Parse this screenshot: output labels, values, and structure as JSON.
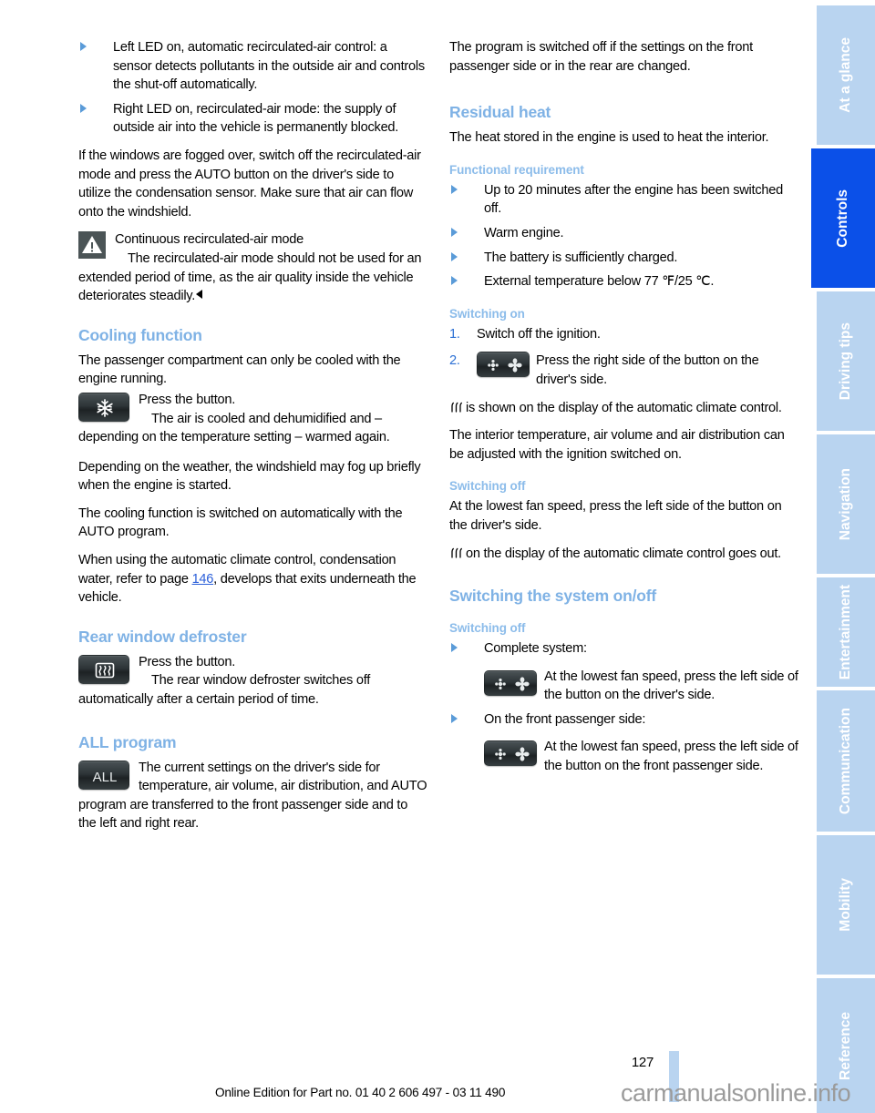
{
  "document": {
    "page_number": "127",
    "footer_note": "Online Edition for Part no. 01 40 2 606 497 - 03 11 490",
    "watermark": "carmanualsonline.info"
  },
  "colors": {
    "heading_blue": "#7fb2e5",
    "subheading_blue": "#8cbcea",
    "link_blue": "#2b5fd9",
    "tab_inactive": "#b9d4f0",
    "tab_active": "#0b50e8",
    "warning_icon_bg": "#4b5456",
    "button_dark": "#2e3538"
  },
  "left_column": {
    "bullets_top": [
      "Left LED on, automatic recirculated-air con-trol: a sensor detects pollutants in the out-side air and controls the shut-off automati-cally.",
      "Right LED on, recirculated-air mode: the supply of outside air into the vehicle is per-manently blocked."
    ],
    "bullet1_text": "Left LED on, automatic recirculated-air control: a sensor detects pollutants in the outside air and controls the shut-off automatically.",
    "bullet2_text": "Right LED on, recirculated-air mode: the supply of outside air into the vehicle is permanently blocked.",
    "para_fogged": "If the windows are fogged over, switch off the recirculated-air mode and press the AUTO button on the driver's side to utilize the condensation sensor. Make sure that air can flow onto the windshield.",
    "warning": {
      "icon": "warning-triangle-icon",
      "title": "Continuous recirculated-air mode",
      "body": "The recirculated-air mode should not be used for an extended period of time, as the air quality inside the vehicle deteriorates steadily."
    },
    "cooling": {
      "heading": "Cooling function",
      "intro": "The passenger compartment can only be cooled with the engine running.",
      "button_icon": "snowflake-button-icon",
      "press": "Press the button.",
      "result": "The air is cooled and dehumidified and – depending on the temperature setting – warmed again.",
      "fog_note": "Depending on the weather, the windshield may fog up briefly when the engine is started.",
      "auto_note": "The cooling function is switched on automatically with the AUTO program.",
      "condensation_pre": "When using the automatic climate control, condensation water, refer to page ",
      "condensation_page": "146",
      "condensation_post": ", develops that exits underneath the vehicle."
    },
    "defroster": {
      "heading": "Rear window defroster",
      "button_icon": "rear-window-defroster-button-icon",
      "press": "Press the button.",
      "body": "The rear window defroster switches off automatically after a certain period of time."
    },
    "all_program": {
      "heading": "ALL program",
      "button_label": "ALL",
      "body": "The current settings on the driver's side for temperature, air volume, air distribution, and AUTO program are transferred to the front passenger side and to the left and right rear."
    }
  },
  "right_column": {
    "intro_para": "The program is switched off if the settings on the front passenger side or in the rear are changed.",
    "residual_heat": {
      "heading": "Residual heat",
      "intro": "The heat stored in the engine is used to heat the interior.",
      "functional_requirement": {
        "heading": "Functional requirement",
        "items": [
          "Up to 20 minutes after the engine has been switched off.",
          "Warm engine.",
          "The battery is sufficiently charged.",
          "External temperature below 77 ℉/25 ℃."
        ]
      },
      "switching_on": {
        "heading": "Switching on",
        "steps": [
          {
            "num": "1.",
            "text": "Switch off the ignition."
          },
          {
            "num": "2.",
            "text": "Press the right side of the button on the driver's side.",
            "icon": "fan-snowflake-button-icon"
          }
        ],
        "display_note_pre": "is shown on the display of the automatic climate control.",
        "display_glyph": "residual-heat-glyph",
        "adjust_note": "The interior temperature, air volume and air distribution can be adjusted with the ignition switched on."
      },
      "switching_off": {
        "heading": "Switching off",
        "body": "At the lowest fan speed, press the left side of the button on the driver's side.",
        "display_note": "on the display of the automatic climate control goes out."
      }
    },
    "system_onoff": {
      "heading": "Switching the system on/off",
      "switching_off_heading": "Switching off",
      "items": [
        {
          "label": "Complete system:",
          "icon": "fan-snowflake-button-icon",
          "text": "At the lowest fan speed, press the left side of the button on the driver's side."
        },
        {
          "label": "On the front passenger side:",
          "icon": "fan-snowflake-button-icon",
          "text": "At the lowest fan speed, press the left side of the button on the front passenger side."
        }
      ]
    }
  },
  "rail": {
    "tabs": [
      {
        "label": "At a glance",
        "active": false
      },
      {
        "label": "Controls",
        "active": true
      },
      {
        "label": "Driving tips",
        "active": false
      },
      {
        "label": "Navigation",
        "active": false
      },
      {
        "label": "Entertainment",
        "active": false
      },
      {
        "label": "Communication",
        "active": false
      },
      {
        "label": "Mobility",
        "active": false
      },
      {
        "label": "Reference",
        "active": false
      }
    ]
  }
}
